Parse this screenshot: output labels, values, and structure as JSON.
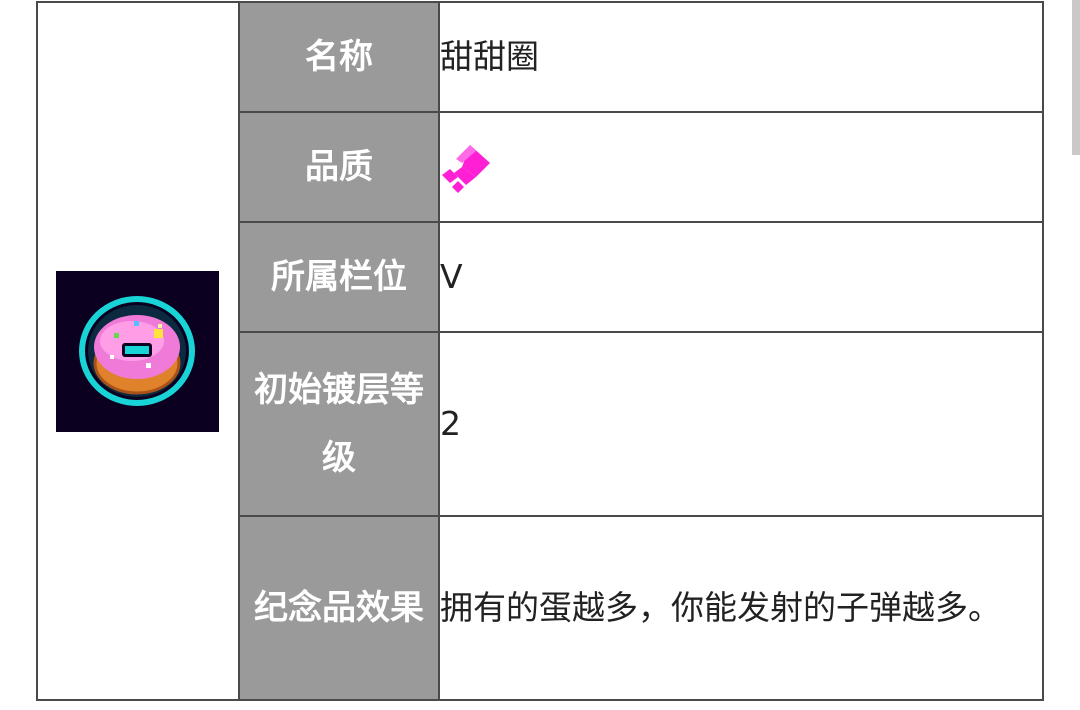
{
  "item": {
    "image_icon": "pink-donut-pixel-icon",
    "rows": [
      {
        "key": "名称",
        "value": "甜甜圈"
      },
      {
        "key": "品质",
        "value_icon": "magenta-quality-gem-icon",
        "value_color": "#ff1fd4"
      },
      {
        "key": "所属栏位",
        "value": "V"
      },
      {
        "key": "初始镀层等级",
        "value": "2"
      },
      {
        "key": "纪念品效果",
        "value": "拥有的蛋越多，你能发射的子弹越多。"
      }
    ]
  },
  "colors": {
    "key_background": "#9a9a9a",
    "border": "#4a4a4a",
    "icon_background": "#0b0020"
  }
}
